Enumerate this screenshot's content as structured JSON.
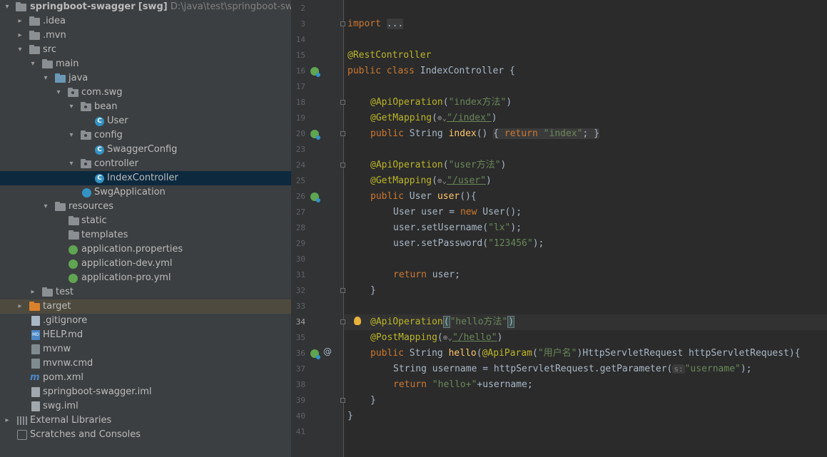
{
  "project_tree": {
    "root": {
      "name": "springboot-swagger",
      "module": "[swg]",
      "path": "D:\\java\\test\\springboot-swagger"
    },
    "items": [
      {
        "label": ".idea"
      },
      {
        "label": ".mvn"
      },
      {
        "label": "src"
      },
      {
        "label": "main"
      },
      {
        "label": "java"
      },
      {
        "label": "com.swg"
      },
      {
        "label": "bean"
      },
      {
        "label": "User"
      },
      {
        "label": "config"
      },
      {
        "label": "SwaggerConfig"
      },
      {
        "label": "controller"
      },
      {
        "label": "IndexController"
      },
      {
        "label": "SwgApplication"
      },
      {
        "label": "resources"
      },
      {
        "label": "static"
      },
      {
        "label": "templates"
      },
      {
        "label": "application.properties"
      },
      {
        "label": "application-dev.yml"
      },
      {
        "label": "application-pro.yml"
      },
      {
        "label": "test"
      },
      {
        "label": "target"
      },
      {
        "label": ".gitignore"
      },
      {
        "label": "HELP.md"
      },
      {
        "label": "mvnw"
      },
      {
        "label": "mvnw.cmd"
      },
      {
        "label": "pom.xml"
      },
      {
        "label": "springboot-swagger.iml"
      },
      {
        "label": "swg.iml"
      },
      {
        "label": "External Libraries"
      },
      {
        "label": "Scratches and Consoles"
      }
    ],
    "md_badge": "MD",
    "class_badge": "C",
    "maven_badge": "m"
  },
  "editor": {
    "line_numbers": [
      "2",
      "3",
      "14",
      "15",
      "16",
      "17",
      "18",
      "19",
      "20",
      "23",
      "24",
      "25",
      "26",
      "27",
      "28",
      "29",
      "30",
      "31",
      "32",
      "33",
      "34",
      "35",
      "36",
      "37",
      "38",
      "39",
      "40",
      "41"
    ],
    "current_line": "34",
    "code": {
      "import_kw": "import",
      "import_fold": "...",
      "rest_controller": "@RestController",
      "public": "public",
      "class": "class",
      "class_name": "IndexController",
      "open_brace": " {",
      "api_op": "@ApiOperation",
      "get_mapping": "@GetMapping",
      "post_mapping": "@PostMapping",
      "api_param": "@ApiParam",
      "index_desc": "\"index方法\"",
      "index_path": "\"/index\"",
      "user_desc": "\"user方法\"",
      "user_path": "\"/user\"",
      "hello_desc": "\"hello方法\"",
      "hello_path": "\"/hello\"",
      "string": "String",
      "user_type": "User",
      "index_fn": "index",
      "user_fn": "user",
      "hello_fn": "hello",
      "return": "return",
      "index_str": "\"index\"",
      "new": "new",
      "l27_var": " user = ",
      "l27_ctor": " User();",
      "set_username": "user.setUsername(",
      "lx": "\"lx\"",
      "set_password": "user.setPassword(",
      "pwd": "\"123456\"",
      "return_user": " user;",
      "close_brace": "}",
      "user_param_desc": "\"用户名\"",
      "hello_params": ")HttpServletRequest httpServletRequest){",
      "l37_a": " username = httpServletRequest.getParameter(",
      "param_hint": "s:",
      "username_str": "\"username\"",
      "l37_end": ");",
      "hello_plus": "\"hello+\"",
      "l38_end": "+username;",
      "globe": "⊕⌄",
      "at_marker": "@"
    }
  },
  "colors": {
    "keyword": "#cc7832",
    "annotation": "#bbb529",
    "string": "#6a8759",
    "function": "#ffc66d",
    "text": "#a9b7c6",
    "selection": "#0d293e"
  }
}
